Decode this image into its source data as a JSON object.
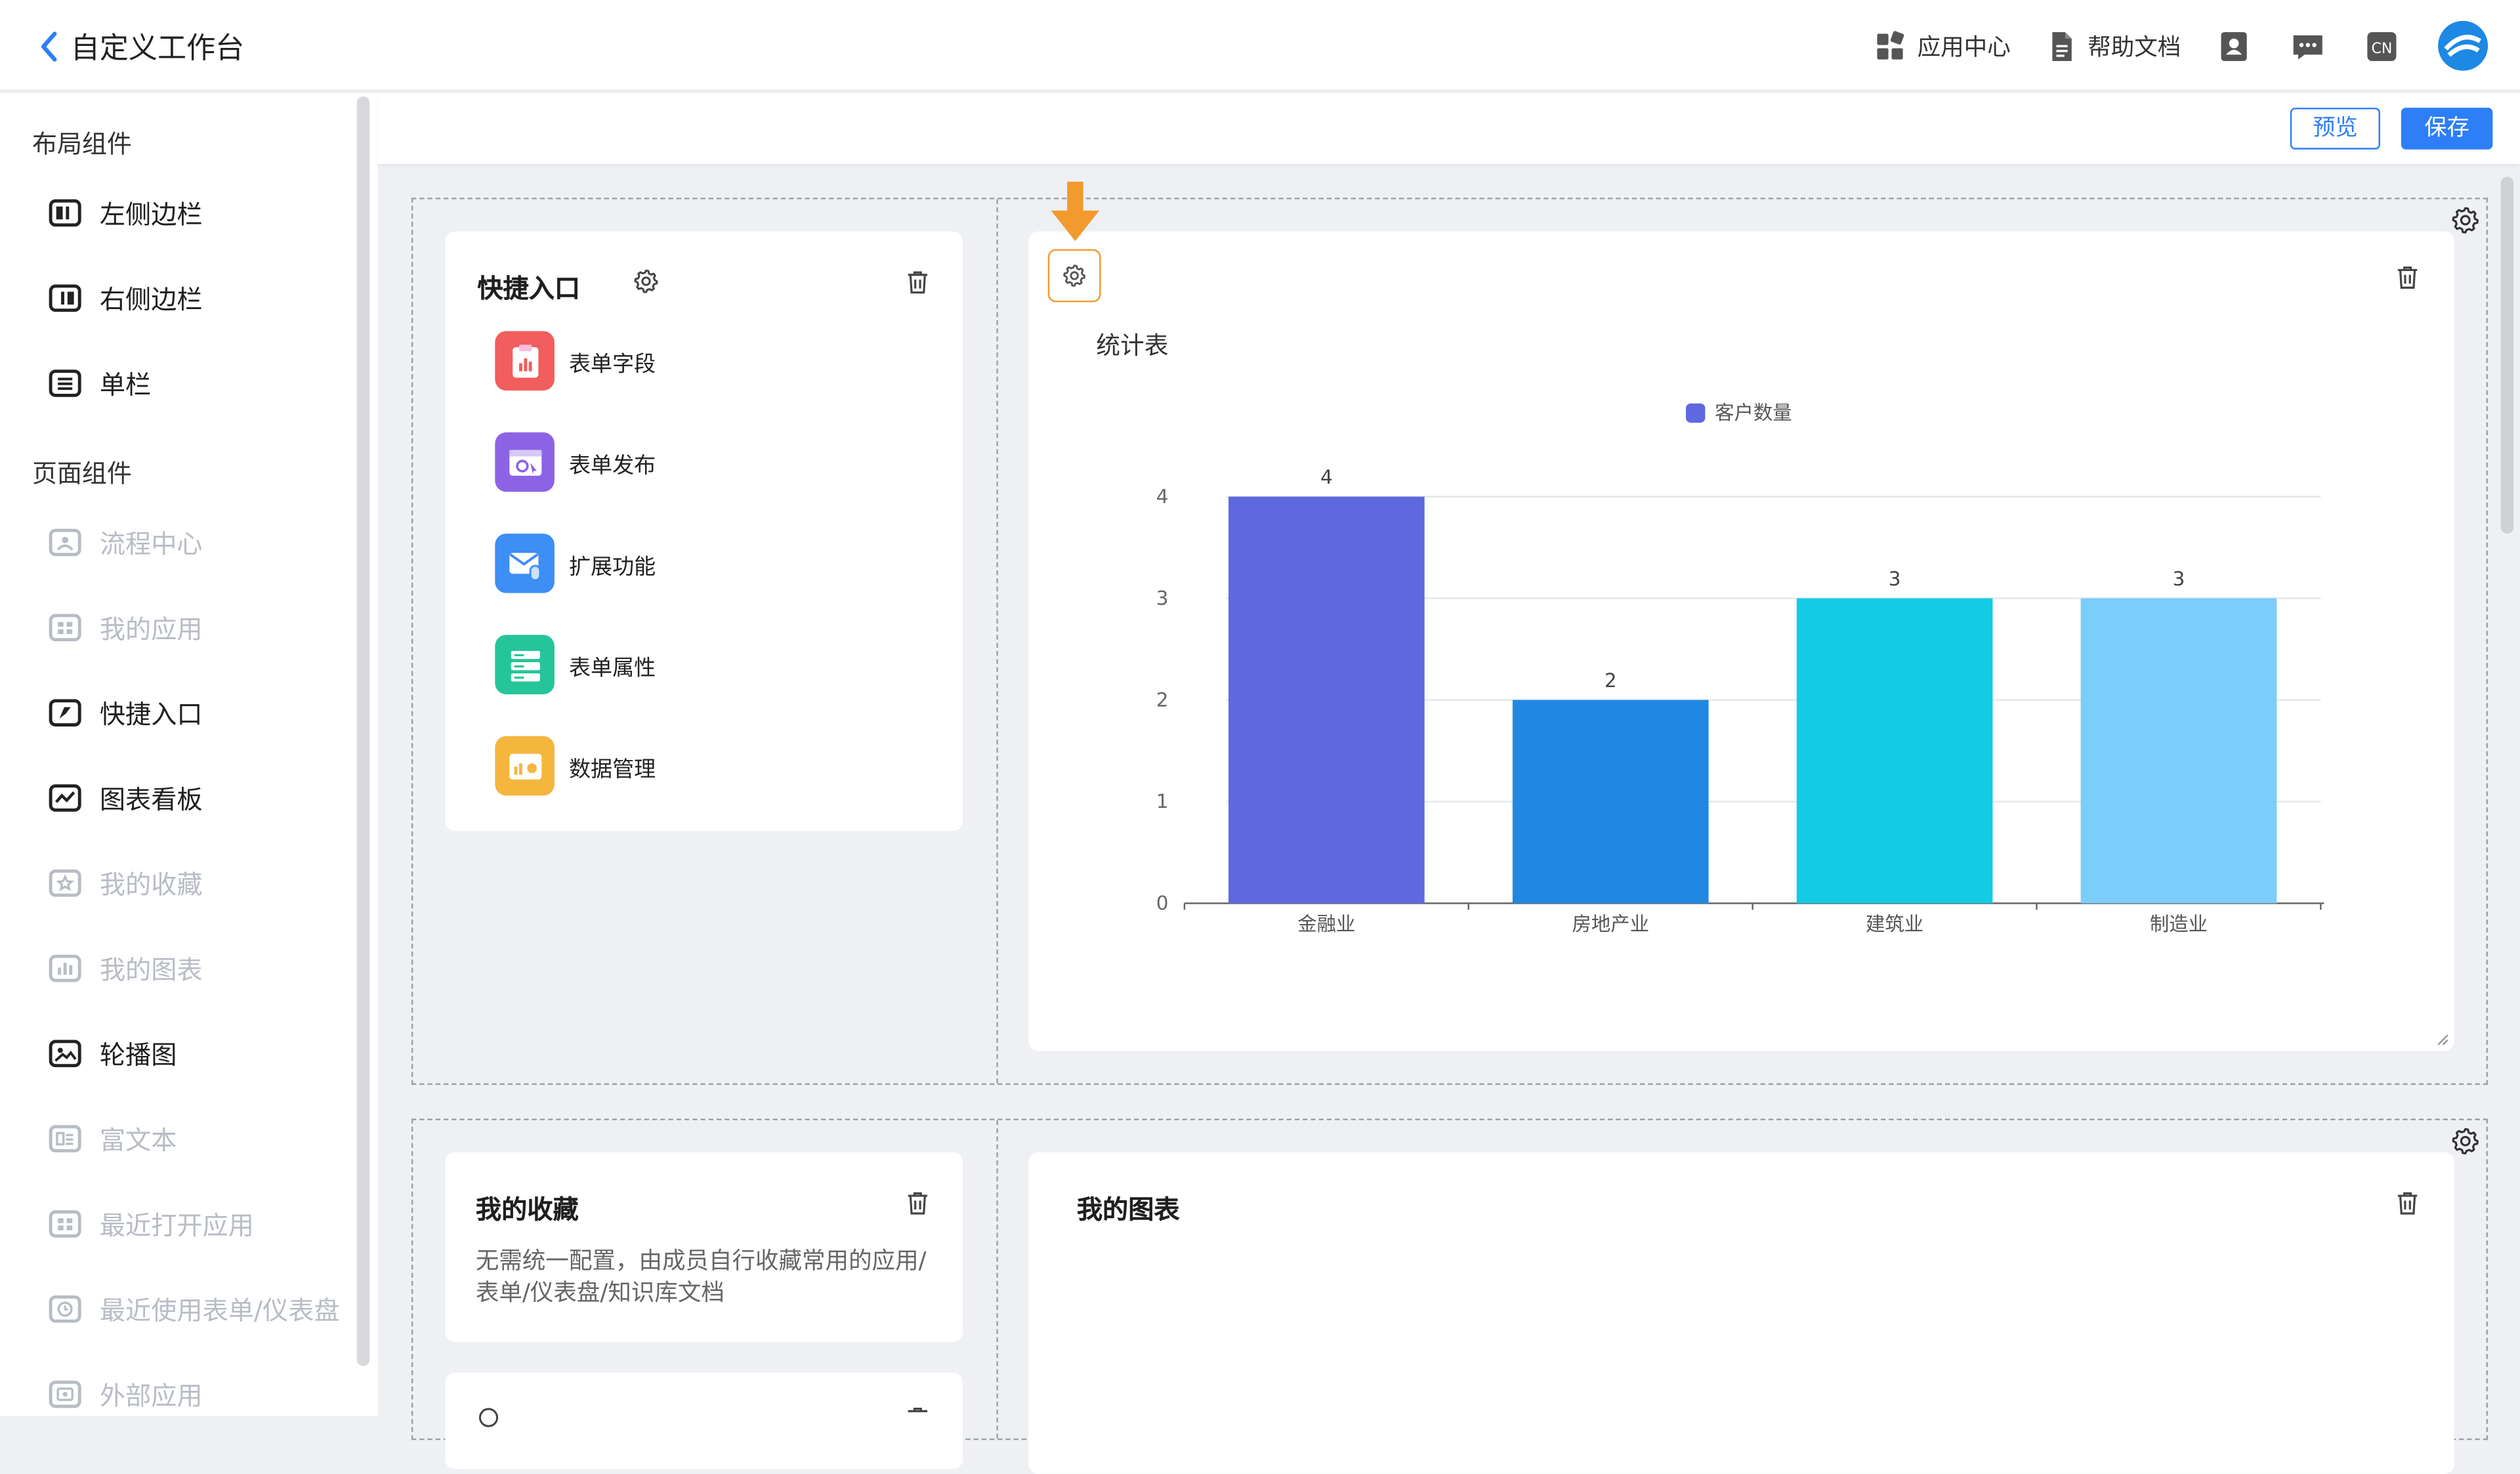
{
  "header": {
    "title": "自定义工作台",
    "nav": {
      "app_center": "应用中心",
      "help_docs": "帮助文档"
    },
    "lang_badge": "CN"
  },
  "sidebar": {
    "layout_section": "布局组件",
    "layout_items": [
      {
        "label": "左侧边栏",
        "icon": "left-sidebar-icon"
      },
      {
        "label": "右侧边栏",
        "icon": "right-sidebar-icon"
      },
      {
        "label": "单栏",
        "icon": "single-column-icon"
      }
    ],
    "page_section": "页面组件",
    "page_items": [
      {
        "label": "流程中心",
        "enabled": false,
        "icon": "process-icon"
      },
      {
        "label": "我的应用",
        "enabled": false,
        "icon": "apps-icon"
      },
      {
        "label": "快捷入口",
        "enabled": true,
        "icon": "shortcut-icon"
      },
      {
        "label": "图表看板",
        "enabled": true,
        "icon": "chart-board-icon"
      },
      {
        "label": "我的收藏",
        "enabled": false,
        "icon": "favorite-icon"
      },
      {
        "label": "我的图表",
        "enabled": false,
        "icon": "my-chart-icon"
      },
      {
        "label": "轮播图",
        "enabled": true,
        "icon": "carousel-icon"
      },
      {
        "label": "富文本",
        "enabled": false,
        "icon": "rich-text-icon"
      },
      {
        "label": "最近打开应用",
        "enabled": false,
        "icon": "recent-apps-icon"
      },
      {
        "label": "最近使用表单/仪表盘",
        "enabled": false,
        "icon": "recent-forms-icon"
      },
      {
        "label": "外部应用",
        "enabled": false,
        "icon": "external-app-icon"
      }
    ]
  },
  "toolbar": {
    "preview": "预览",
    "save": "保存"
  },
  "quick_entry": {
    "title": "快捷入口",
    "items": [
      {
        "label": "表单字段",
        "color": "#f25d5d"
      },
      {
        "label": "表单发布",
        "color": "#8d63e6"
      },
      {
        "label": "扩展功能",
        "color": "#3d8ef5"
      },
      {
        "label": "表单属性",
        "color": "#25c59a"
      },
      {
        "label": "数据管理",
        "color": "#f5b63d"
      }
    ]
  },
  "stats_card": {
    "title": "统计表"
  },
  "chart_data": {
    "type": "bar",
    "title": "统计表",
    "categories": [
      "金融业",
      "房地产业",
      "建筑业",
      "制造业"
    ],
    "series": [
      {
        "name": "客户数量",
        "values": [
          4,
          2,
          3,
          3
        ]
      }
    ],
    "bar_colors": [
      "#5f68df",
      "#2088e3",
      "#14cbe4",
      "#7bcdfa"
    ],
    "ylim": [
      0,
      4
    ],
    "yticks": [
      0,
      1,
      2,
      3,
      4
    ],
    "grid": true,
    "legend": "top-center",
    "data_labels": true
  },
  "favorites": {
    "title": "我的收藏",
    "desc": "无需统一配置，由成员自行收藏常用的应用/表单/仪表盘/知识库文档"
  },
  "my_charts": {
    "title": "我的图表"
  },
  "colors": {
    "accent": "#2d7ef7",
    "highlight": "#f29a2e"
  }
}
